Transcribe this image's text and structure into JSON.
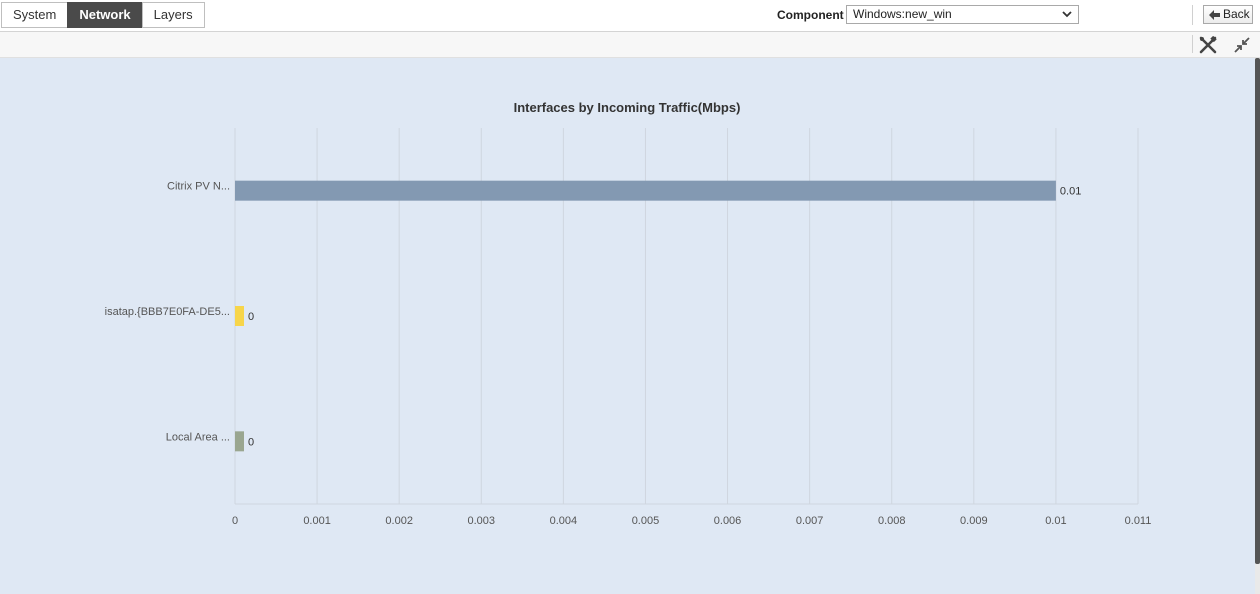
{
  "tabs": [
    {
      "label": "System",
      "active": false
    },
    {
      "label": "Network",
      "active": true
    },
    {
      "label": "Layers",
      "active": false
    }
  ],
  "component": {
    "label": "Component",
    "selected": "Windows:new_win"
  },
  "back_button": {
    "label": "Back",
    "icon": "back-arrow-icon"
  },
  "toolbar": {
    "icons": [
      "tools-icon",
      "collapse-icon"
    ]
  },
  "colors": {
    "background": "#dfe8f4",
    "bar1": "#8399b2",
    "bar2": "#f7d54a",
    "bar3": "#9aa690",
    "active_tab": "#4a4a4a"
  },
  "chart_data": {
    "type": "bar",
    "orientation": "horizontal",
    "title": "Interfaces by Incoming Traffic(Mbps)",
    "categories": [
      "Citrix PV N...",
      "isatap.{BBB7E0FA-DE5...",
      "Local Area ..."
    ],
    "values": [
      0.01,
      0,
      0
    ],
    "data_labels": [
      "0.01",
      "0",
      "0"
    ],
    "xlim": [
      0,
      0.011
    ],
    "x_ticks": [
      "0",
      "0.001",
      "0.002",
      "0.003",
      "0.004",
      "0.005",
      "0.006",
      "0.007",
      "0.008",
      "0.009",
      "0.01",
      "0.011"
    ],
    "grid": true,
    "colors": [
      "#8399b2",
      "#f7d54a",
      "#9aa690"
    ]
  }
}
